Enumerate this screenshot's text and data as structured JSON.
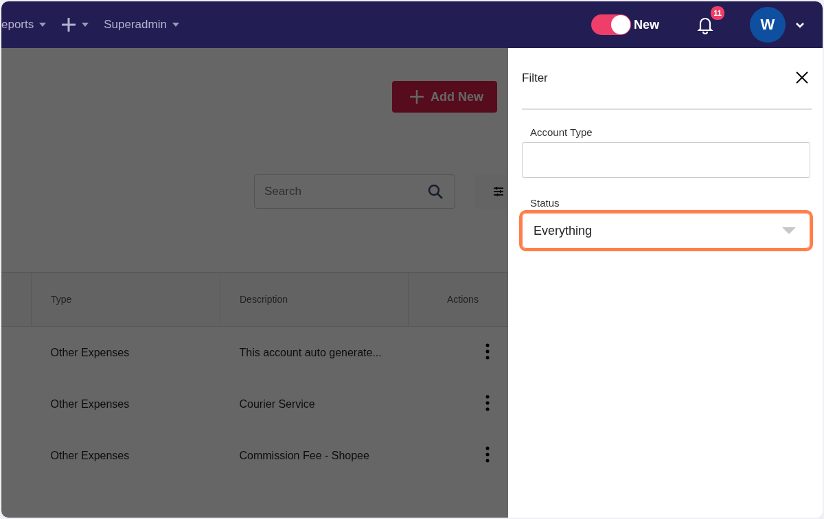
{
  "nav": {
    "menus": [
      {
        "kind": "text",
        "label": "eports"
      },
      {
        "kind": "add"
      },
      {
        "kind": "text",
        "label": "Superadmin"
      }
    ],
    "toggle": {
      "label": "New",
      "on": true
    },
    "notifications": {
      "count": "11"
    },
    "avatar": {
      "initial": "W"
    }
  },
  "page": {
    "add_button": "Add New",
    "search": {
      "placeholder": "Search"
    },
    "table": {
      "columns": [
        "Type",
        "Description",
        "Actions"
      ],
      "rows": [
        {
          "type": "Other Expenses",
          "description": "This account auto generate..."
        },
        {
          "type": "Other Expenses",
          "description": "Courier Service"
        },
        {
          "type": "Other Expenses",
          "description": "Commission Fee - Shopee"
        }
      ]
    }
  },
  "filter": {
    "title": "Filter",
    "fields": [
      {
        "kind": "text",
        "label": "Account Type"
      },
      {
        "kind": "select",
        "label": "Status",
        "value": "Everything",
        "highlighted": true
      }
    ]
  }
}
